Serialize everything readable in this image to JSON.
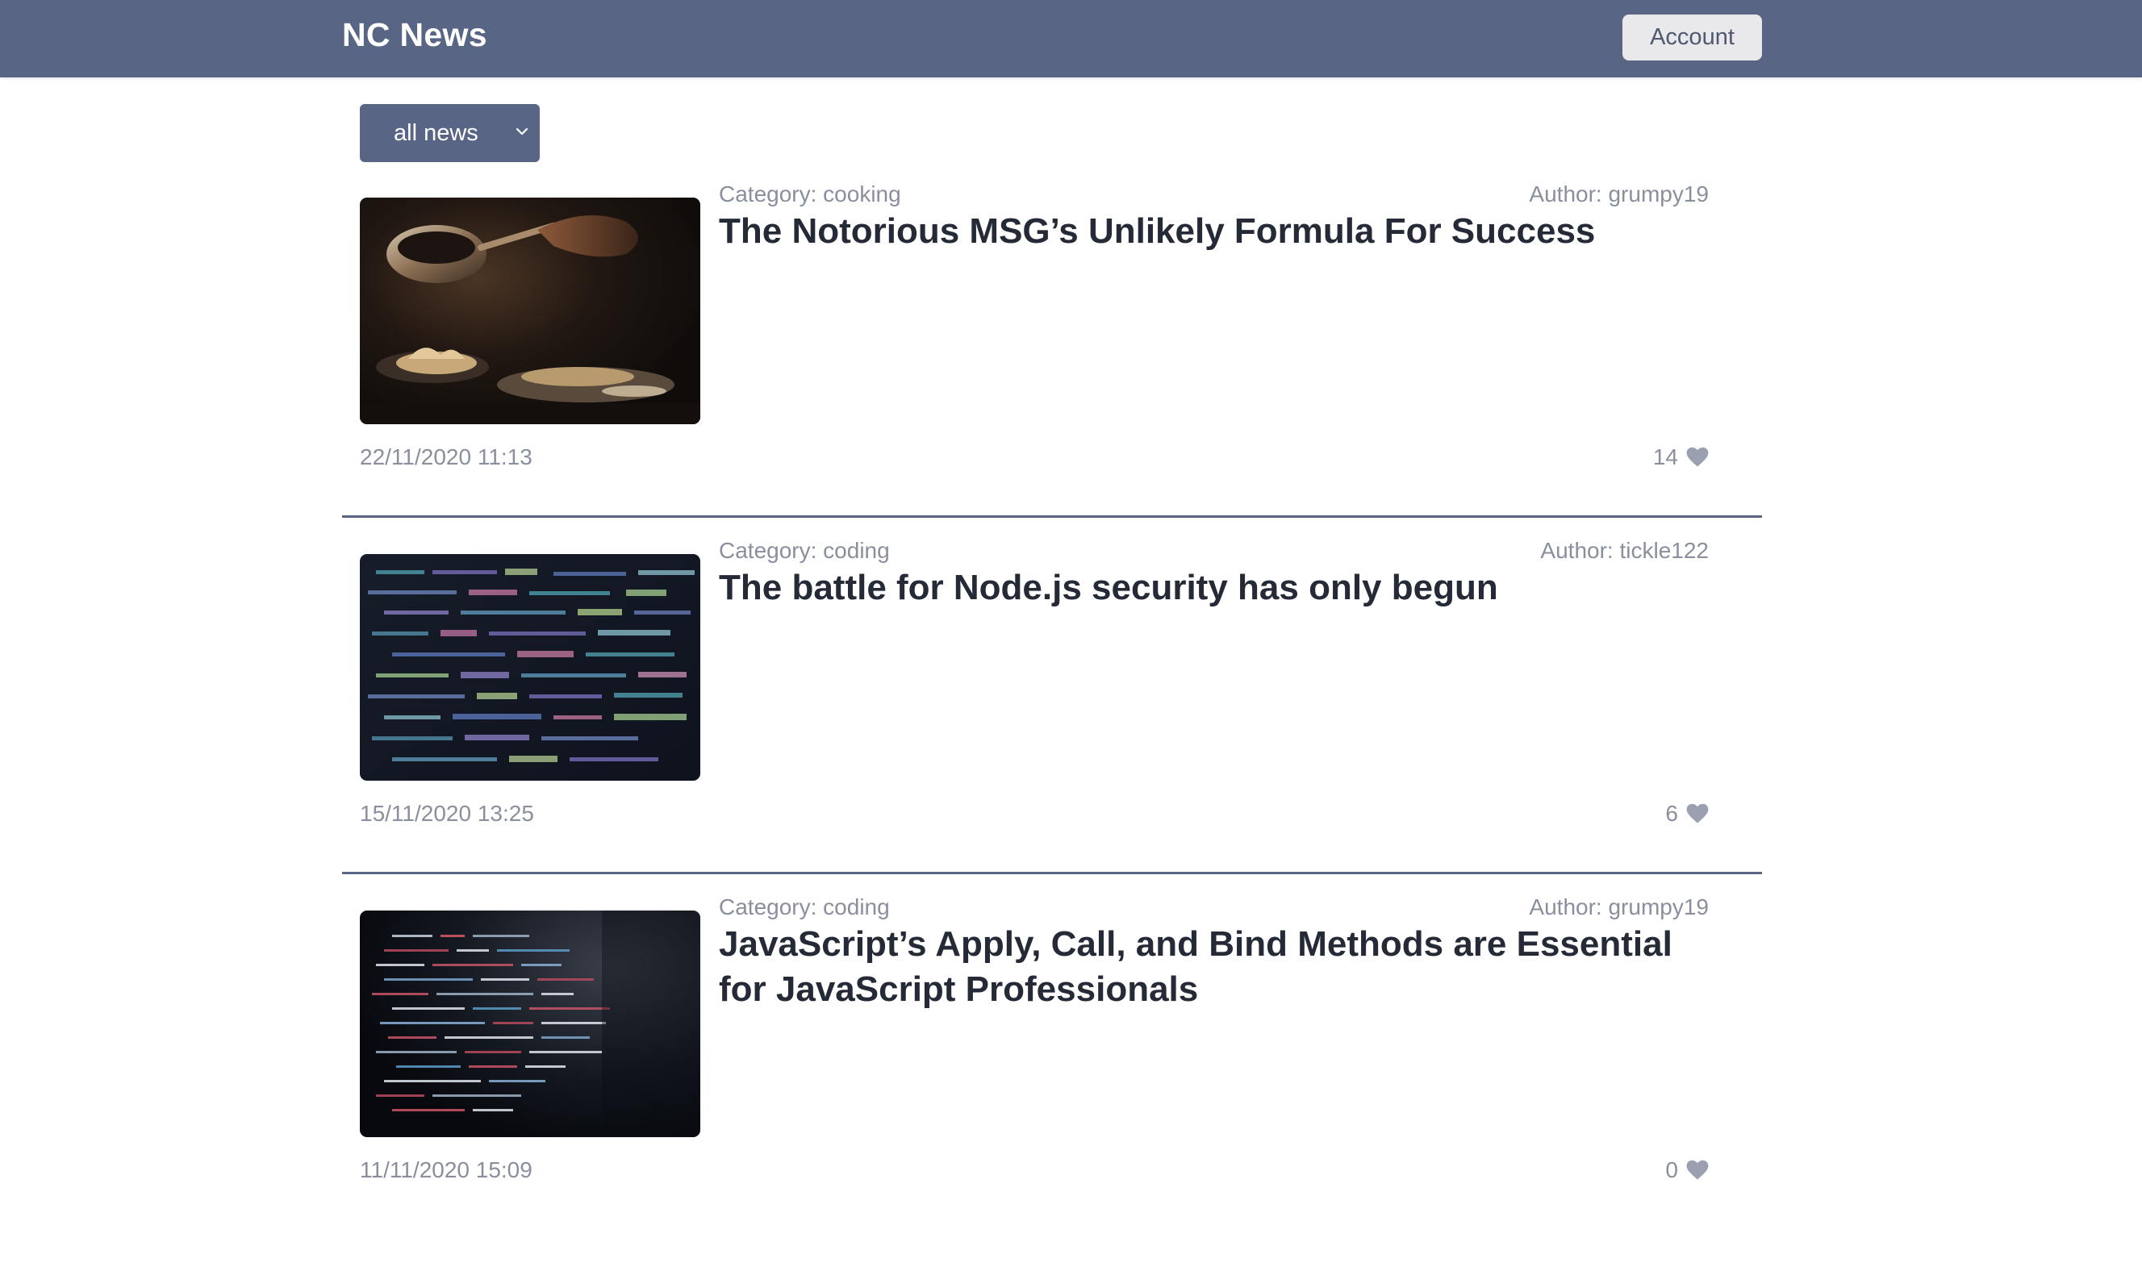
{
  "header": {
    "brand": "NC News",
    "account_label": "Account"
  },
  "filter": {
    "selected": "all news"
  },
  "articles": [
    {
      "category": "Category: cooking",
      "author": "Author: grumpy19",
      "title": "The Notorious MSG’s Unlikely Formula For Success",
      "date": "22/11/2020 11:13",
      "votes": "14"
    },
    {
      "category": "Category: coding",
      "author": "Author: tickle122",
      "title": "The battle for Node.js security has only begun",
      "date": "15/11/2020 13:25",
      "votes": "6"
    },
    {
      "category": "Category: coding",
      "author": "Author: grumpy19",
      "title": "JavaScript’s Apply, Call, and Bind Methods are Essential for JavaScript Professionals",
      "date": "11/11/2020 15:09",
      "votes": "0"
    }
  ],
  "colors": {
    "header_bg": "#596585",
    "meta_text": "#8a8f9e",
    "title_text": "#252a37",
    "divider": "#596585",
    "heart": "#9aa0b0"
  }
}
